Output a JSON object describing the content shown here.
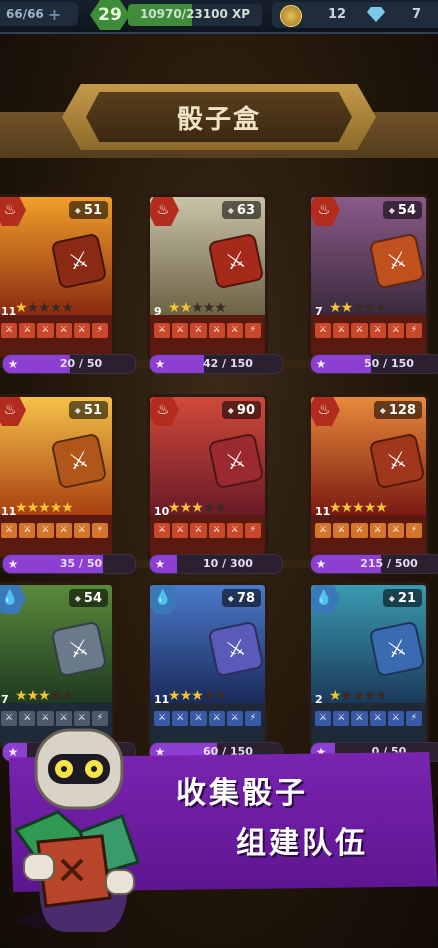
{
  "topbar": {
    "hp": "66/66",
    "hp_plus": "+",
    "level": "29",
    "xp": "10970/23100 XP",
    "xp_progress": 0.475,
    "coins": "12",
    "gems": "7"
  },
  "title": "骰子盒",
  "cards": [
    {
      "power": "51",
      "level": "11",
      "stars": 1,
      "progress": "20 / 50",
      "ratio": 0.4
    },
    {
      "power": "63",
      "level": "9",
      "stars": 2,
      "progress": "42 / 150",
      "ratio": 0.28
    },
    {
      "power": "54",
      "level": "7",
      "stars": 2,
      "progress": "50 / 150",
      "ratio": 0.33
    },
    {
      "power": "51",
      "level": "11",
      "stars": 5,
      "progress": "35 / 50",
      "ratio": 0.7
    },
    {
      "power": "90",
      "level": "10",
      "stars": 3,
      "progress": "10 / 300",
      "ratio": 0.03
    },
    {
      "power": "128",
      "level": "11",
      "stars": 5,
      "progress": "215 / 500",
      "ratio": 0.43
    },
    {
      "power": "54",
      "level": "7",
      "stars": 3,
      "progress": "",
      "ratio": 0
    },
    {
      "power": "78",
      "level": "11",
      "stars": 3,
      "progress": "60 / 150",
      "ratio": 0.4
    },
    {
      "power": "21",
      "level": "2",
      "stars": 1,
      "progress": "0 / 50",
      "ratio": 0
    }
  ],
  "promo": {
    "line1": "收集骰子",
    "line2": "组建队伍"
  }
}
